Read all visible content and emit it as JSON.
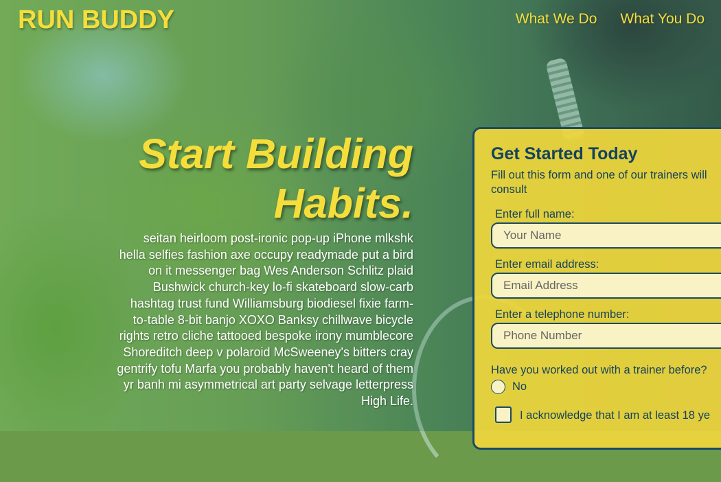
{
  "header": {
    "logo": "RUN BUDDY",
    "nav": [
      {
        "label": "What We Do"
      },
      {
        "label": "What You Do"
      }
    ]
  },
  "hero": {
    "title_line1": "Start Building",
    "title_line2": "Habits.",
    "body": "seitan heirloom post-ironic pop-up iPhone mlkshk hella selfies fashion axe occupy readymade put a bird on it messenger bag Wes Anderson Schlitz plaid Bushwick church-key lo-fi skateboard slow-carb hashtag trust fund Williamsburg biodiesel fixie farm-to-table 8-bit banjo XOXO Banksy chillwave bicycle rights retro cliche tattooed bespoke irony mumblecore Shoreditch deep v polaroid McSweeney's bitters cray gentrify tofu Marfa you probably haven't heard of them yr banh mi asymmetrical art party selvage letterpress High Life."
  },
  "form": {
    "title": "Get Started Today",
    "intro_line1": "Fill out this form and one of our trainers will",
    "intro_line2": "consult",
    "name": {
      "label": "Enter full name:",
      "placeholder": "Your Name",
      "value": ""
    },
    "email": {
      "label": "Enter email address:",
      "placeholder": "Email Address",
      "value": ""
    },
    "phone": {
      "label": "Enter a telephone number:",
      "placeholder": "Phone Number",
      "value": ""
    },
    "trainer_question": "Have you worked out with a trainer before?",
    "radio_no_label": "No",
    "acknowledge_label": "I acknowledge that I am at least 18 ye"
  },
  "colors": {
    "accent_yellow": "#f5de3c",
    "form_bg": "#f0d73c",
    "navy": "#14425e",
    "input_bg": "#f8f2c4"
  }
}
